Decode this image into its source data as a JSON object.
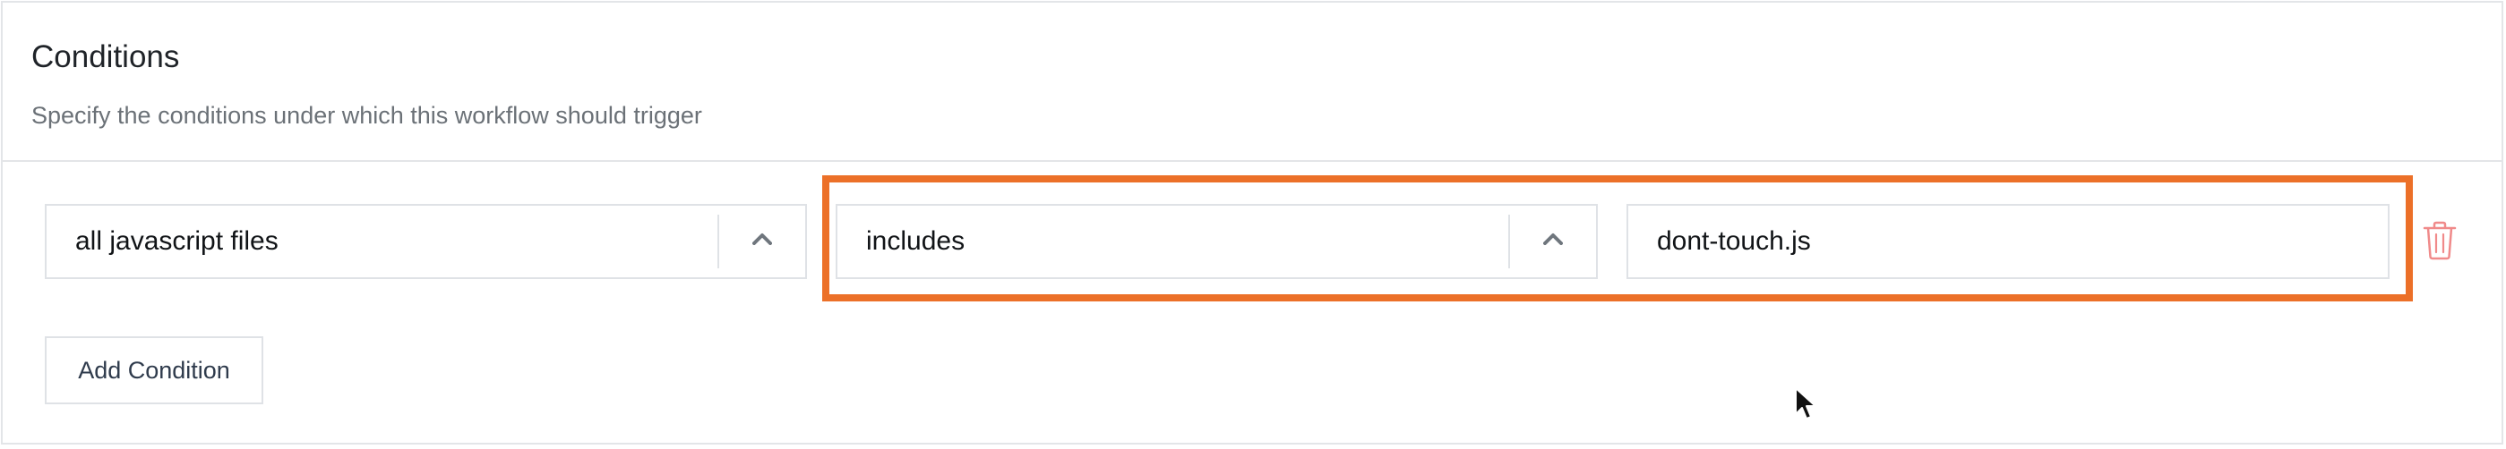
{
  "section": {
    "title": "Conditions",
    "subtitle": "Specify the conditions under which this workflow should trigger"
  },
  "condition_row": {
    "field_select": {
      "value": "all javascript files",
      "icon": "chevron-up-icon"
    },
    "operator_select": {
      "value": "includes",
      "icon": "chevron-up-icon"
    },
    "value_input": {
      "value": "dont-touch.js"
    },
    "delete_icon": "trash-icon",
    "highlight_color": "#ec7028"
  },
  "actions": {
    "add_condition_label": "Add Condition"
  },
  "colors": {
    "title": "#1f2328",
    "subtitle": "#6b7177",
    "border": "#dfe2e6",
    "delete": "#f08a8a",
    "chevron": "#6f767d"
  }
}
